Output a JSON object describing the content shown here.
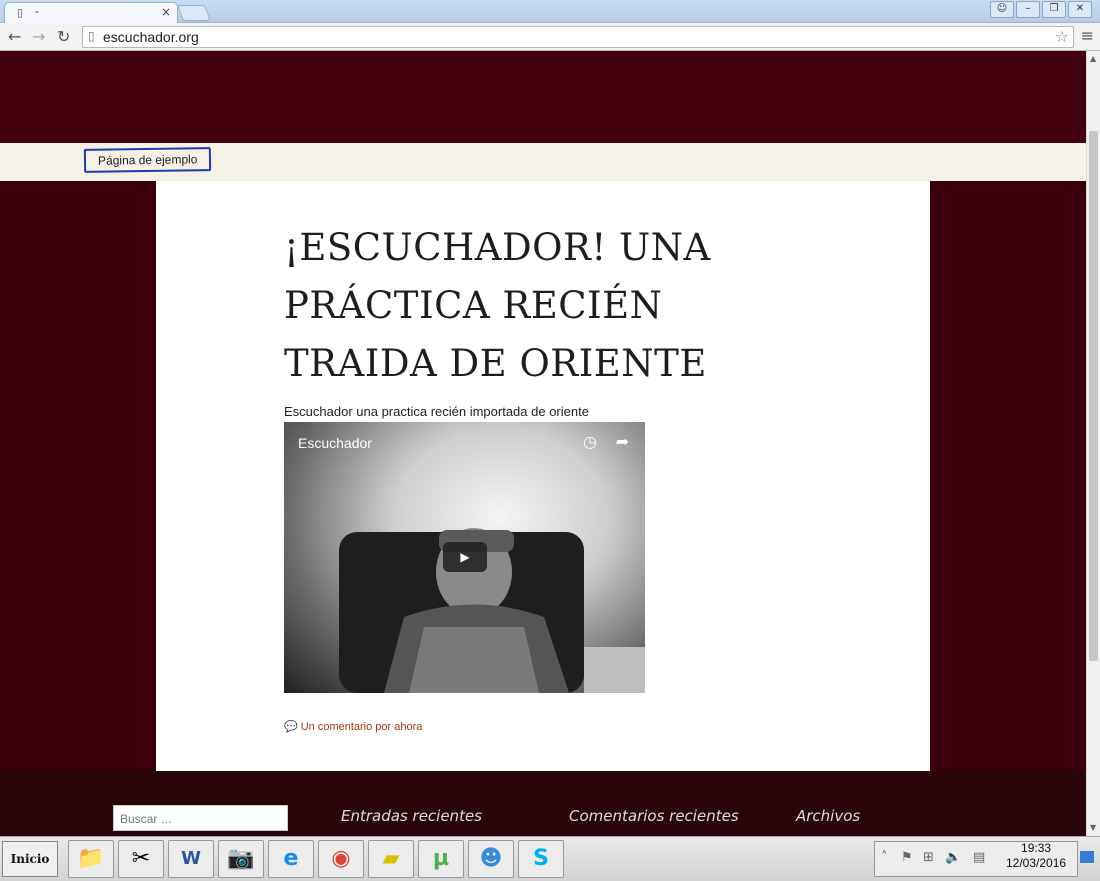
{
  "browser": {
    "tab_title": "-",
    "tab_close": "×",
    "url": "escuchador.org",
    "window_controls": [
      "person-icon",
      "minimize-icon",
      "restore-icon",
      "close-icon"
    ]
  },
  "site": {
    "nav_link": "Página de ejemplo",
    "post_title": "¡ESCUCHADOR! UNA PRÁCTICA RECIÉN TRAIDA DE ORIENTE",
    "post_text": "Escuchador una practica recién importada de oriente",
    "video_title": "Escuchador",
    "comments_link": "Un comentario por ahora",
    "search_placeholder": "Buscar …",
    "footer_headings": [
      "Entradas recientes",
      "Comentarios recientes",
      "Archivos"
    ]
  },
  "taskbar": {
    "start_label": "Inicio",
    "apps": [
      "explorer-icon",
      "snipping-icon",
      "word-icon",
      "camera-icon",
      "internet-explorer-icon",
      "chrome-icon",
      "sticky-notes-icon",
      "utorrent-icon",
      "messenger-icon",
      "skype-icon"
    ],
    "time": "19:33",
    "date": "12/03/2016"
  },
  "colors": {
    "header": "#43000f",
    "nav_bar": "#f6f1e6",
    "link": "#a23a0e",
    "footer": "#2a060b"
  }
}
